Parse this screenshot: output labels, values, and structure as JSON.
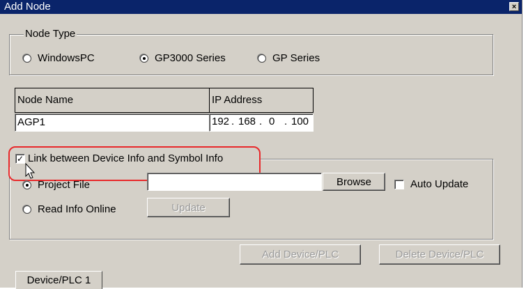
{
  "window": {
    "title": "Add Node",
    "close_glyph": "×"
  },
  "node_type": {
    "legend": "Node Type",
    "options": [
      {
        "label": "WindowsPC",
        "selected": false
      },
      {
        "label": "GP3000 Series",
        "selected": true
      },
      {
        "label": "GP Series",
        "selected": false
      }
    ]
  },
  "node_table": {
    "headers": [
      "Node Name",
      "IP Address"
    ],
    "node_name": "AGP1",
    "ip": [
      "192",
      "168",
      "0",
      "100"
    ],
    "ip_separator": "."
  },
  "link": {
    "checkbox_label": "Link between Device Info and Symbol Info",
    "checked": true,
    "check_glyph": "✓",
    "project_file_label": "Project File",
    "project_file_value": "",
    "browse_label": "Browse",
    "auto_update_label": "Auto Update",
    "auto_update_checked": false,
    "read_online_label": "Read Info Online",
    "update_label": "Update"
  },
  "buttons": {
    "add_device": "Add Device/PLC",
    "delete_device": "Delete Device/PLC"
  },
  "tabs": [
    {
      "label": "Device/PLC 1"
    }
  ],
  "colors": {
    "title_bar": "#0a246a",
    "dialog_bg": "#d4d0c8",
    "highlight": "#e8282a"
  }
}
